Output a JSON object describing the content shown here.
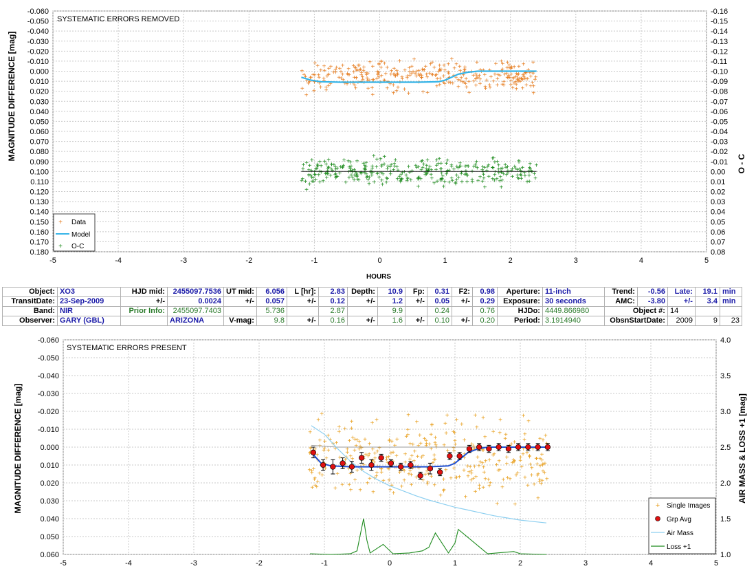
{
  "colors": {
    "data": "#e67c1e",
    "model": "#35b4e8",
    "oc": "#1c8a1c",
    "single": "#e8a020",
    "grp": "#e01010",
    "grp_model": "#1f4fd1",
    "airmass": "#8ccff0",
    "loss": "#1c8a1c",
    "grid": "#c8c8c8"
  },
  "chart_data": [
    {
      "type": "scatter",
      "title": "SYSTEMATIC ERRORS REMOVED",
      "xlabel": "HOURS",
      "ylabel": "MAGNITUDE DIFFERENCE [mag]",
      "y2label": "O - C",
      "xlim": [
        -5,
        5
      ],
      "ylim": [
        -0.06,
        0.18
      ],
      "y2lim": [
        -0.16,
        0.08
      ],
      "y_reversed": true,
      "grid": true,
      "legend_position": "bottom-left",
      "x_ticks": [
        "-5",
        "-4",
        "-3",
        "-2",
        "-1",
        "0",
        "1",
        "2",
        "3",
        "4",
        "5"
      ],
      "y_ticks": [
        "-0.060",
        "-0.050",
        "-0.040",
        "-0.030",
        "-0.020",
        "-0.010",
        "0.000",
        "0.010",
        "0.020",
        "0.030",
        "0.040",
        "0.050",
        "0.060",
        "0.070",
        "0.080",
        "0.090",
        "0.100",
        "0.110",
        "0.120",
        "0.130",
        "0.140",
        "0.150",
        "0.160",
        "0.170",
        "0.180"
      ],
      "y2_ticks": [
        "-0.16",
        "-0.15",
        "-0.14",
        "-0.13",
        "-0.12",
        "-0.11",
        "-0.10",
        "-0.09",
        "-0.08",
        "-0.07",
        "-0.06",
        "-0.05",
        "-0.04",
        "-0.03",
        "-0.02",
        "-0.01",
        "0.00",
        "0.01",
        "0.02",
        "0.03",
        "0.04",
        "0.05",
        "0.06",
        "0.07",
        "0.08"
      ],
      "legend": [
        "Data",
        "Model",
        "O-C"
      ],
      "data_range": {
        "x": [
          -1.2,
          2.4
        ],
        "center": 0.005,
        "scatter": 0.009
      },
      "oc_range": {
        "x": [
          -1.2,
          2.4
        ],
        "center": 0.1,
        "scatter": 0.008
      },
      "model": {
        "x": [
          -1.2,
          -1.05,
          -0.9,
          -0.6,
          -0.3,
          0,
          0.3,
          0.6,
          0.9,
          1.0,
          1.1,
          1.2,
          1.35,
          1.5,
          2.0,
          2.4
        ],
        "y": [
          0.006,
          0.009,
          0.0105,
          0.011,
          0.011,
          0.011,
          0.011,
          0.011,
          0.0105,
          0.009,
          0.006,
          0.003,
          0.001,
          0.0,
          0.0,
          0.0
        ]
      },
      "oc_line": {
        "x": [
          -1.2,
          2.4
        ],
        "y": [
          0.1,
          0.1
        ]
      }
    },
    {
      "type": "scatter",
      "title": "SYSTEMATIC ERRORS PRESENT",
      "xlabel": "",
      "ylabel": "MAGNITUDE DIFFERENCE [mag]",
      "y2label": "AIR MASS & LOSS +1 [mag]",
      "xlim": [
        -5,
        5
      ],
      "ylim": [
        -0.06,
        0.06
      ],
      "y2lim": [
        1.0,
        4.0
      ],
      "y_reversed": true,
      "grid": true,
      "legend_position": "bottom-right",
      "x_ticks": [
        "-5",
        "-4",
        "-3",
        "-2",
        "-1",
        "0",
        "1",
        "2",
        "3",
        "4",
        "5"
      ],
      "y_ticks": [
        "-0.060",
        "-0.050",
        "-0.040",
        "-0.030",
        "-0.020",
        "-0.010",
        "0.000",
        "0.010",
        "0.020",
        "0.030",
        "0.040",
        "0.050",
        "0.060"
      ],
      "y2_ticks": [
        "4.0",
        "3.5",
        "3.0",
        "2.5",
        "2.0",
        "1.5",
        "1.0"
      ],
      "legend": [
        "Single Images",
        "Grp Avg",
        "Air Mass",
        "Loss +1"
      ],
      "single_range": {
        "x": [
          -1.25,
          2.42
        ],
        "center": 0.006,
        "scatter": 0.012
      },
      "grp_avg": {
        "x": [
          -1.17,
          -1.02,
          -0.87,
          -0.72,
          -0.58,
          -0.43,
          -0.28,
          -0.13,
          0.02,
          0.17,
          0.32,
          0.47,
          0.62,
          0.77,
          0.92,
          1.07,
          1.22,
          1.37,
          1.52,
          1.67,
          1.82,
          1.97,
          2.12,
          2.27,
          2.42
        ],
        "y": [
          0.003,
          0.01,
          0.011,
          0.009,
          0.011,
          0.006,
          0.01,
          0.006,
          0.009,
          0.011,
          0.01,
          0.016,
          0.012,
          0.014,
          0.005,
          0.005,
          0.001,
          0.0,
          0.001,
          0.0,
          0.001,
          0.0,
          0.0,
          0.0,
          0.0
        ],
        "err": [
          0.003,
          0.003,
          0.004,
          0.003,
          0.003,
          0.003,
          0.003,
          0.002,
          0.002,
          0.002,
          0.002,
          0.002,
          0.003,
          0.002,
          0.002,
          0.002,
          0.002,
          0.002,
          0.002,
          0.002,
          0.002,
          0.002,
          0.002,
          0.002,
          0.002
        ]
      },
      "model": {
        "x": [
          -1.2,
          -1.05,
          -0.9,
          -0.6,
          -0.3,
          0,
          0.3,
          0.6,
          0.9,
          1.0,
          1.1,
          1.2,
          1.35,
          1.5,
          2.0,
          2.4
        ],
        "y": [
          0.003,
          0.009,
          0.0105,
          0.011,
          0.011,
          0.011,
          0.011,
          0.011,
          0.0105,
          0.009,
          0.006,
          0.003,
          0.001,
          0.0,
          0.0,
          0.0
        ]
      },
      "airmass": {
        "x": [
          -1.2,
          -1.0,
          -0.8,
          -0.6,
          -0.4,
          -0.2,
          0.0,
          0.2,
          0.4,
          0.6,
          0.8,
          1.0,
          1.2,
          1.4,
          1.6,
          1.8,
          2.0,
          2.2,
          2.4
        ],
        "y": [
          2.8,
          2.68,
          2.48,
          2.3,
          2.16,
          2.05,
          1.96,
          1.89,
          1.82,
          1.76,
          1.71,
          1.66,
          1.62,
          1.58,
          1.54,
          1.51,
          1.48,
          1.46,
          1.44
        ]
      },
      "loss": {
        "x": [
          -1.22,
          -0.9,
          -0.6,
          -0.5,
          -0.45,
          -0.4,
          -0.35,
          -0.3,
          -0.1,
          0.05,
          0.3,
          0.5,
          0.6,
          0.7,
          0.9,
          1.0,
          1.05,
          1.5,
          1.9,
          2.0,
          2.4
        ],
        "y": [
          1.01,
          1.0,
          1.01,
          1.05,
          1.28,
          1.5,
          1.2,
          1.02,
          1.14,
          1.01,
          1.02,
          1.05,
          1.1,
          1.3,
          1.02,
          1.16,
          1.35,
          1.01,
          1.04,
          1.01,
          1.0
        ]
      }
    }
  ],
  "info": {
    "row1": [
      "Object:",
      "XO3",
      "HJD mid:",
      "2455097.7536",
      "UT mid:",
      "6.056",
      "L [hr]:",
      "2.83",
      "Depth:",
      "10.9",
      "Fp:",
      "0.31",
      "F2:",
      "0.98",
      "Aperture:",
      "11-inch",
      "Trend:",
      "-0.56",
      "Late:",
      "19.1",
      "min"
    ],
    "row2": [
      "TransitDate:",
      "23-Sep-2009",
      "+/-",
      "0.0024",
      "+/-",
      "0.057",
      "+/-",
      "0.12",
      "+/-",
      "1.2",
      "+/-",
      "0.05",
      "+/-",
      "0.29",
      "Exposure:",
      "30 seconds",
      "AMC:",
      "-3.80",
      "+/-",
      "3.4",
      "min"
    ],
    "row3": [
      "Band:",
      "NIR",
      "Prior Info:",
      "2455097.7403",
      "5.736",
      "2.87",
      "9.9",
      "0.24",
      "0.76",
      "HJDo:",
      "4449.866980",
      "Object #:",
      "14"
    ],
    "row4": [
      "Observer:",
      "GARY (GBL)",
      "ARIZONA",
      "V-mag:",
      "9.8",
      "+/-",
      "0.16",
      "+/-",
      "1.6",
      "+/-",
      "0.10",
      "+/-",
      "0.20",
      "Period:",
      "3.1914940",
      "ObsnStartDate:",
      "2009",
      "9",
      "23"
    ]
  }
}
